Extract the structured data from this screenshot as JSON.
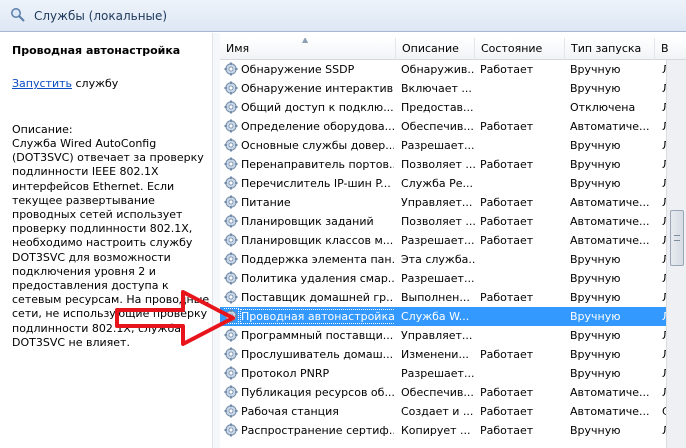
{
  "window": {
    "title": "Службы (локальные)",
    "icon": "magnifier-icon"
  },
  "left_pane": {
    "service_title": "Проводная автонастройка",
    "action_link": "Запустить",
    "action_suffix": " службу",
    "description_label": "Описание:",
    "description": "Служба Wired AutoConfig (DOT3SVC) отвечает за проверку подлинности IEEE 802.1X интерфейсов Ethernet. Если текущее развертывание проводных сетей использует проверку подлинности 802.1X, необходимо настроить службу DOT3SVC для возможности подключения уровня 2 и предоставления доступа к сетевым ресурсам. На проводные сети, не использующие проверку подлинности 802.1X, служба DOT3SVC не влияет."
  },
  "columns": [
    "Имя",
    "Описание",
    "Состояние",
    "Тип запуска",
    "В"
  ],
  "services": [
    {
      "name": "Обнаружение SSDP",
      "description": "Обнаружив...",
      "state": "Работает",
      "startup": "Вручную",
      "extra": "Л"
    },
    {
      "name": "Обнаружение интерактив...",
      "description": "Включает ...",
      "state": "",
      "startup": "Вручную",
      "extra": "Л"
    },
    {
      "name": "Общий доступ к подклю...",
      "description": "Предостав...",
      "state": "",
      "startup": "Отключена",
      "extra": "Л"
    },
    {
      "name": "Определение оборудова...",
      "description": "Обеспечив...",
      "state": "Работает",
      "startup": "Автоматиче...",
      "extra": "Л"
    },
    {
      "name": "Основные службы довер...",
      "description": "Разрешает...",
      "state": "",
      "startup": "Вручную",
      "extra": "Л"
    },
    {
      "name": "Перенаправитель портов...",
      "description": "Позволяет ...",
      "state": "Работает",
      "startup": "Вручную",
      "extra": "Л"
    },
    {
      "name": "Перечислитель IP-шин P...",
      "description": "Служба Ре...",
      "state": "",
      "startup": "Вручную",
      "extra": "Л"
    },
    {
      "name": "Питание",
      "description": "Управляет...",
      "state": "Работает",
      "startup": "Автоматиче...",
      "extra": "Л"
    },
    {
      "name": "Планировщик заданий",
      "description": "Позволяет ...",
      "state": "Работает",
      "startup": "Автоматиче...",
      "extra": "Л"
    },
    {
      "name": "Планировщик классов м...",
      "description": "Разрешает...",
      "state": "Работает",
      "startup": "Автоматиче...",
      "extra": "Л"
    },
    {
      "name": "Поддержка элемента пан...",
      "description": "Эта служба...",
      "state": "",
      "startup": "Вручную",
      "extra": "Л"
    },
    {
      "name": "Политика удаления смар...",
      "description": "Разрешает...",
      "state": "",
      "startup": "Вручную",
      "extra": "Л"
    },
    {
      "name": "Поставщик домашней гр...",
      "description": "Выполнен...",
      "state": "Работает",
      "startup": "Вручную",
      "extra": "Л"
    },
    {
      "name": "Проводная автонастройка",
      "description": "Служба W...",
      "state": "",
      "startup": "Вручную",
      "extra": "Л",
      "selected": true
    },
    {
      "name": "Программный поставщи...",
      "description": "Управляет...",
      "state": "",
      "startup": "Вручную",
      "extra": "Л"
    },
    {
      "name": "Прослушиватель домаш...",
      "description": "Изменени...",
      "state": "Работает",
      "startup": "Вручную",
      "extra": "Л"
    },
    {
      "name": "Протокол PNRP",
      "description": "Разрешает...",
      "state": "",
      "startup": "Вручную",
      "extra": "Л"
    },
    {
      "name": "Публикация ресурсов об...",
      "description": "Обеспечив...",
      "state": "Работает",
      "startup": "Автоматиче...",
      "extra": "Л"
    },
    {
      "name": "Рабочая станция",
      "description": "Создает и ...",
      "state": "Работает",
      "startup": "Автоматиче...",
      "extra": "С"
    },
    {
      "name": "Распространение сертиф...",
      "description": "Копирует ...",
      "state": "Работает",
      "startup": "Вручную",
      "extra": "Л"
    }
  ],
  "icons": {
    "service": "gear-icon",
    "annotation": "red-arrow-icon"
  },
  "colors": {
    "selection": "#3399ff",
    "arrow": "#e8141c",
    "link": "#0b4ec0"
  }
}
